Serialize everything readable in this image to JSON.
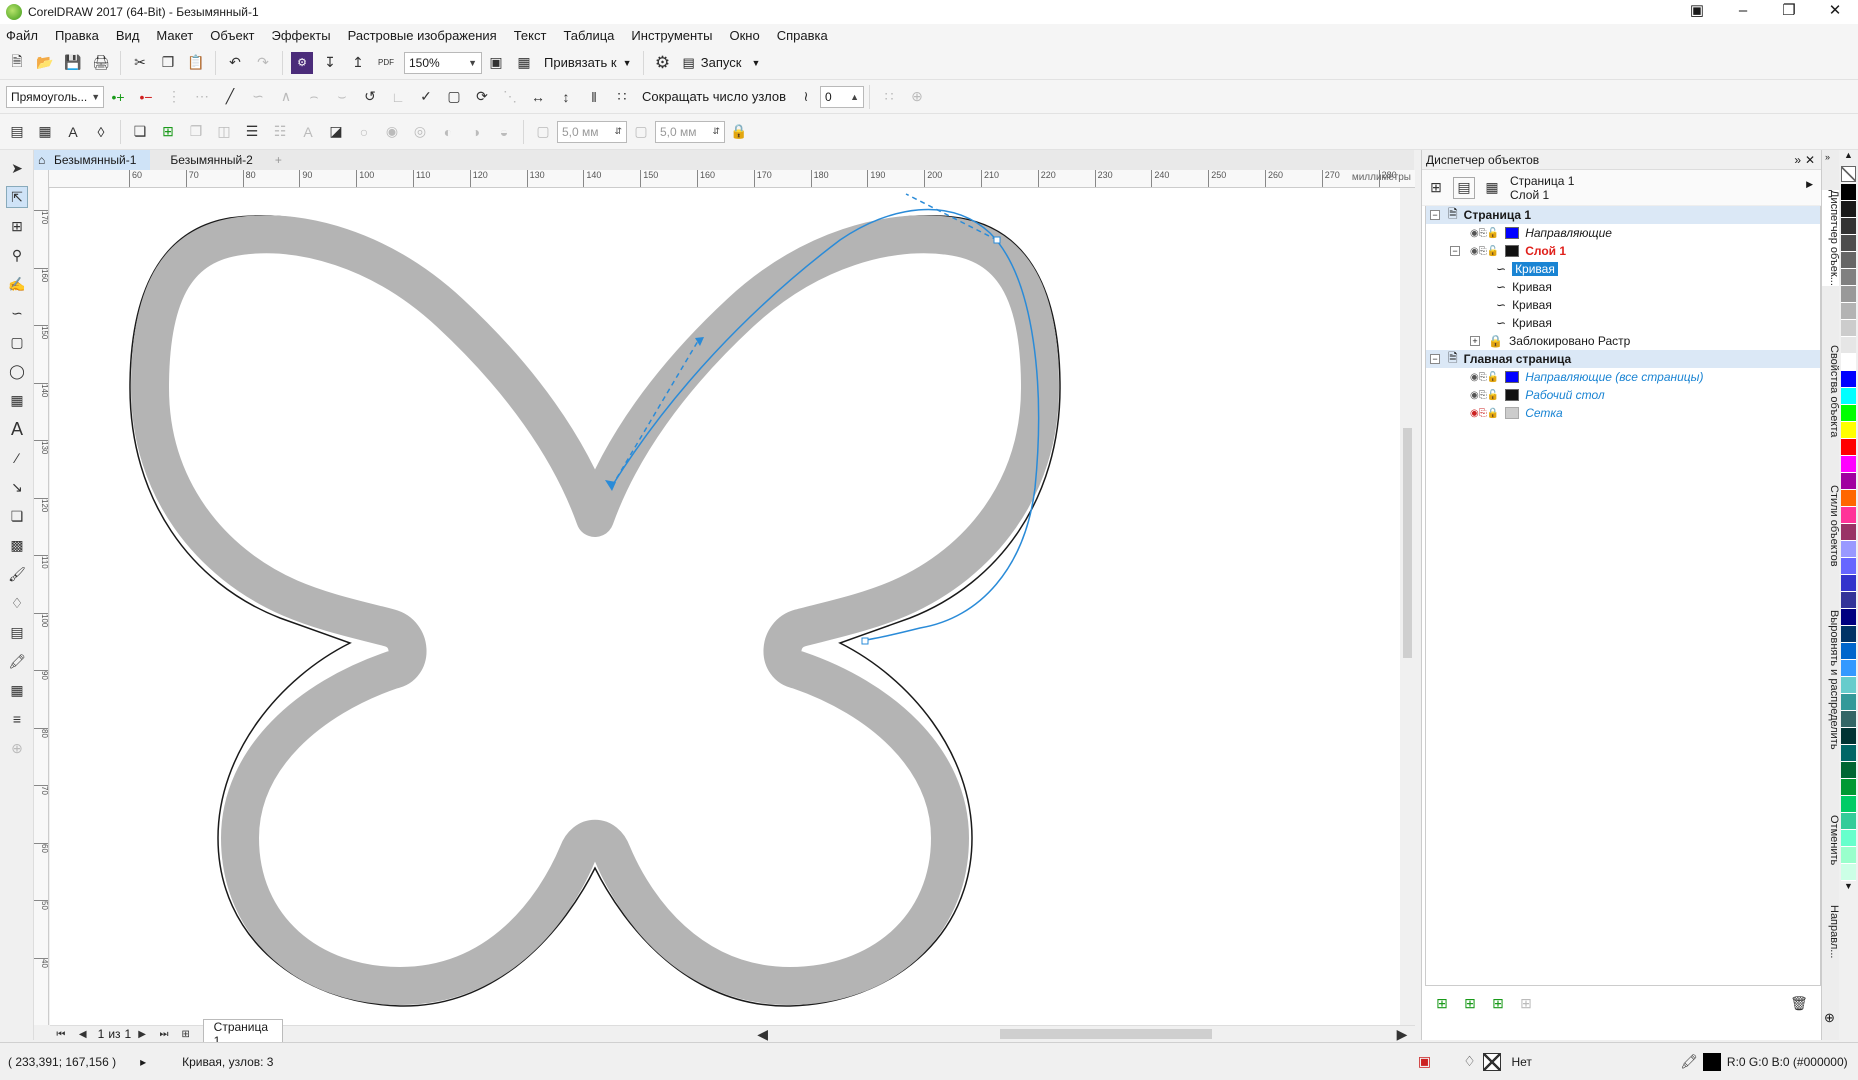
{
  "window": {
    "title": "CorelDRAW 2017 (64-Bit) - Безымянный-1"
  },
  "menu": [
    "Файл",
    "Правка",
    "Вид",
    "Макет",
    "Объект",
    "Эффекты",
    "Растровые изображения",
    "Текст",
    "Таблица",
    "Инструменты",
    "Окно",
    "Справка"
  ],
  "toolbar1": {
    "zoom": "150%",
    "snap_label": "Привязать к",
    "launch_label": "Запуск",
    "pdf_label": "PDF"
  },
  "toolbar2": {
    "shape_combo": "Прямоуголь...",
    "reduce_nodes_label": "Сокращать число узлов",
    "smoothing_value": "0"
  },
  "toolbar3": {
    "corner_h": "5,0 мм",
    "corner_v": "5,0 мм"
  },
  "doc_tabs": [
    "Безымянный-1",
    "Безымянный-2"
  ],
  "ruler": {
    "unit": "миллиметры",
    "h_ticks": [
      "60",
      "70",
      "80",
      "90",
      "100",
      "110",
      "120",
      "130",
      "140",
      "150",
      "160",
      "170",
      "180",
      "190",
      "200",
      "210",
      "220",
      "230",
      "240",
      "250",
      "260",
      "270",
      "280"
    ],
    "v_ticks": [
      "170",
      "160",
      "150",
      "140",
      "130",
      "120",
      "110",
      "100",
      "90",
      "80",
      "70",
      "60",
      "50",
      "40"
    ]
  },
  "page_nav": {
    "position": "1",
    "of_label": "из",
    "total": "1",
    "page_tab": "Страница 1"
  },
  "status": {
    "coords": "( 233,391; 167,156 )",
    "selection": "Кривая, узлов: 3",
    "fill": "Нет",
    "outline_color": "R:0 G:0 B:0 (#000000)"
  },
  "panel": {
    "title": "Диспетчер объектов",
    "header_page": "Страница 1",
    "header_layer": "Слой 1",
    "tree": {
      "page1": "Страница 1",
      "guides": "Направляющие",
      "layer1": "Слой 1",
      "curves": [
        "Кривая",
        "Кривая",
        "Кривая",
        "Кривая"
      ],
      "locked_bitmap": "Заблокировано Растр",
      "master_page": "Главная страница",
      "master_guides": "Направляющие (все страницы)",
      "desktop": "Рабочий стол",
      "grid": "Сетка"
    }
  },
  "side_tabs": [
    "Диспетчер объек...",
    "Свойства объекта",
    "Стили объектов",
    "Выровнять и распределить",
    "Отменить",
    "Направл..."
  ],
  "colors": {
    "accent": "#1a84d3",
    "layer_red": "#e0201b",
    "shape_fill": "#b4b4b4",
    "selection_blue": "#2a8bd8",
    "palette": [
      "#000000",
      "#1a1a1a",
      "#333333",
      "#4d4d4d",
      "#666666",
      "#808080",
      "#999999",
      "#b3b3b3",
      "#cccccc",
      "#e6e6e6",
      "#ffffff",
      "#0000ff",
      "#00ffff",
      "#00ff00",
      "#ffff00",
      "#ff0000",
      "#ff00ff",
      "#a000a0",
      "#ff6600",
      "#ff3399",
      "#993366",
      "#9999ff",
      "#6666ff",
      "#3333cc",
      "#333399",
      "#000080",
      "#003366",
      "#0066cc",
      "#3399ff",
      "#66cccc",
      "#339999",
      "#336666",
      "#003333",
      "#006666",
      "#006633",
      "#009933",
      "#00cc66",
      "#33cc99",
      "#66ffcc",
      "#99ffcc",
      "#ccffe6"
    ]
  }
}
